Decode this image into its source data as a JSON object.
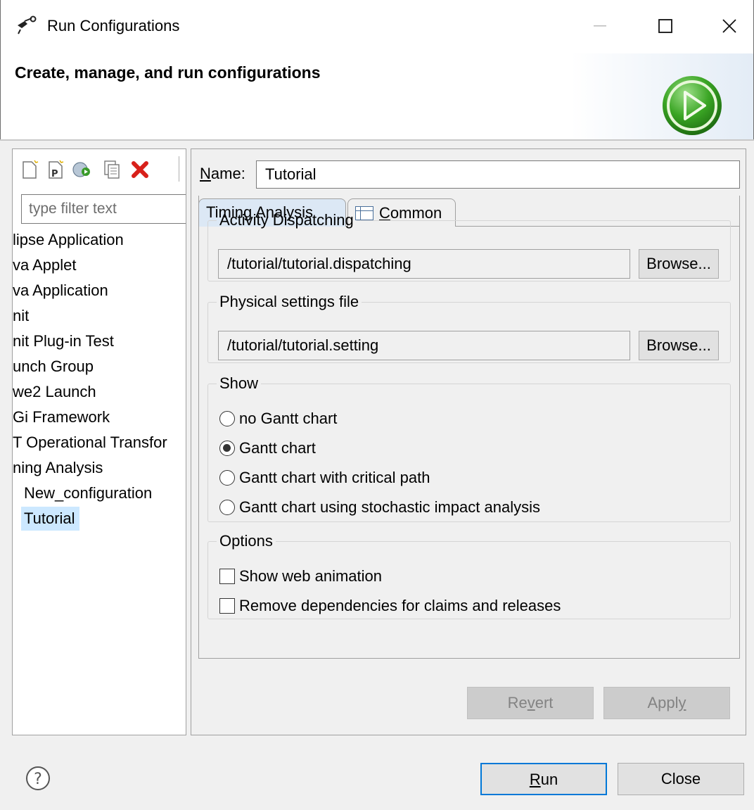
{
  "window": {
    "title": "Run Configurations",
    "header_title": "Create, manage, and run configurations"
  },
  "left": {
    "filter_placeholder": "type filter text",
    "toolbar_icons": [
      "new-config-icon",
      "new-prototype-icon",
      "export-config-icon",
      "duplicate-icon",
      "delete-icon"
    ],
    "tree": [
      {
        "label": "lipse Application"
      },
      {
        "label": "va Applet"
      },
      {
        "label": "va Application"
      },
      {
        "label": "nit"
      },
      {
        "label": "nit Plug-in Test"
      },
      {
        "label": "unch Group"
      },
      {
        "label": "we2 Launch"
      },
      {
        "label": "Gi Framework"
      },
      {
        "label": "T Operational Transfor"
      },
      {
        "label": "ning Analysis"
      },
      {
        "label": "New_configuration"
      },
      {
        "label": "Tutorial",
        "selected": true
      }
    ]
  },
  "form": {
    "name_label_prefix": "N",
    "name_label_rest": "ame:",
    "name_value": "Tutorial",
    "tabs": {
      "active": "Timing Analysis",
      "inactive_prefix": "C",
      "inactive_rest": "ommon"
    },
    "activity": {
      "legend": "Activity Dispatching",
      "path": "/tutorial/tutorial.dispatching",
      "browse": "Browse..."
    },
    "physical": {
      "legend": "Physical settings file",
      "path": "/tutorial/tutorial.setting",
      "browse": "Browse..."
    },
    "show": {
      "legend": "Show",
      "options": [
        {
          "label": "no Gantt chart",
          "selected": false
        },
        {
          "label": "Gantt chart",
          "selected": true
        },
        {
          "label": "Gantt chart with critical path",
          "selected": false
        },
        {
          "label": "Gantt chart using stochastic impact analysis",
          "selected": false
        }
      ]
    },
    "options": {
      "legend": "Options",
      "items": [
        {
          "label": "Show web animation",
          "checked": false
        },
        {
          "label": "Remove dependencies for claims and releases",
          "checked": false
        }
      ]
    },
    "revert": {
      "pre": "Re",
      "mn": "v",
      "post": "ert"
    },
    "apply": {
      "pre": "Appl",
      "mn": "y",
      "post": ""
    }
  },
  "footer": {
    "run": {
      "mn": "R",
      "post": "un"
    },
    "close": "Close"
  }
}
